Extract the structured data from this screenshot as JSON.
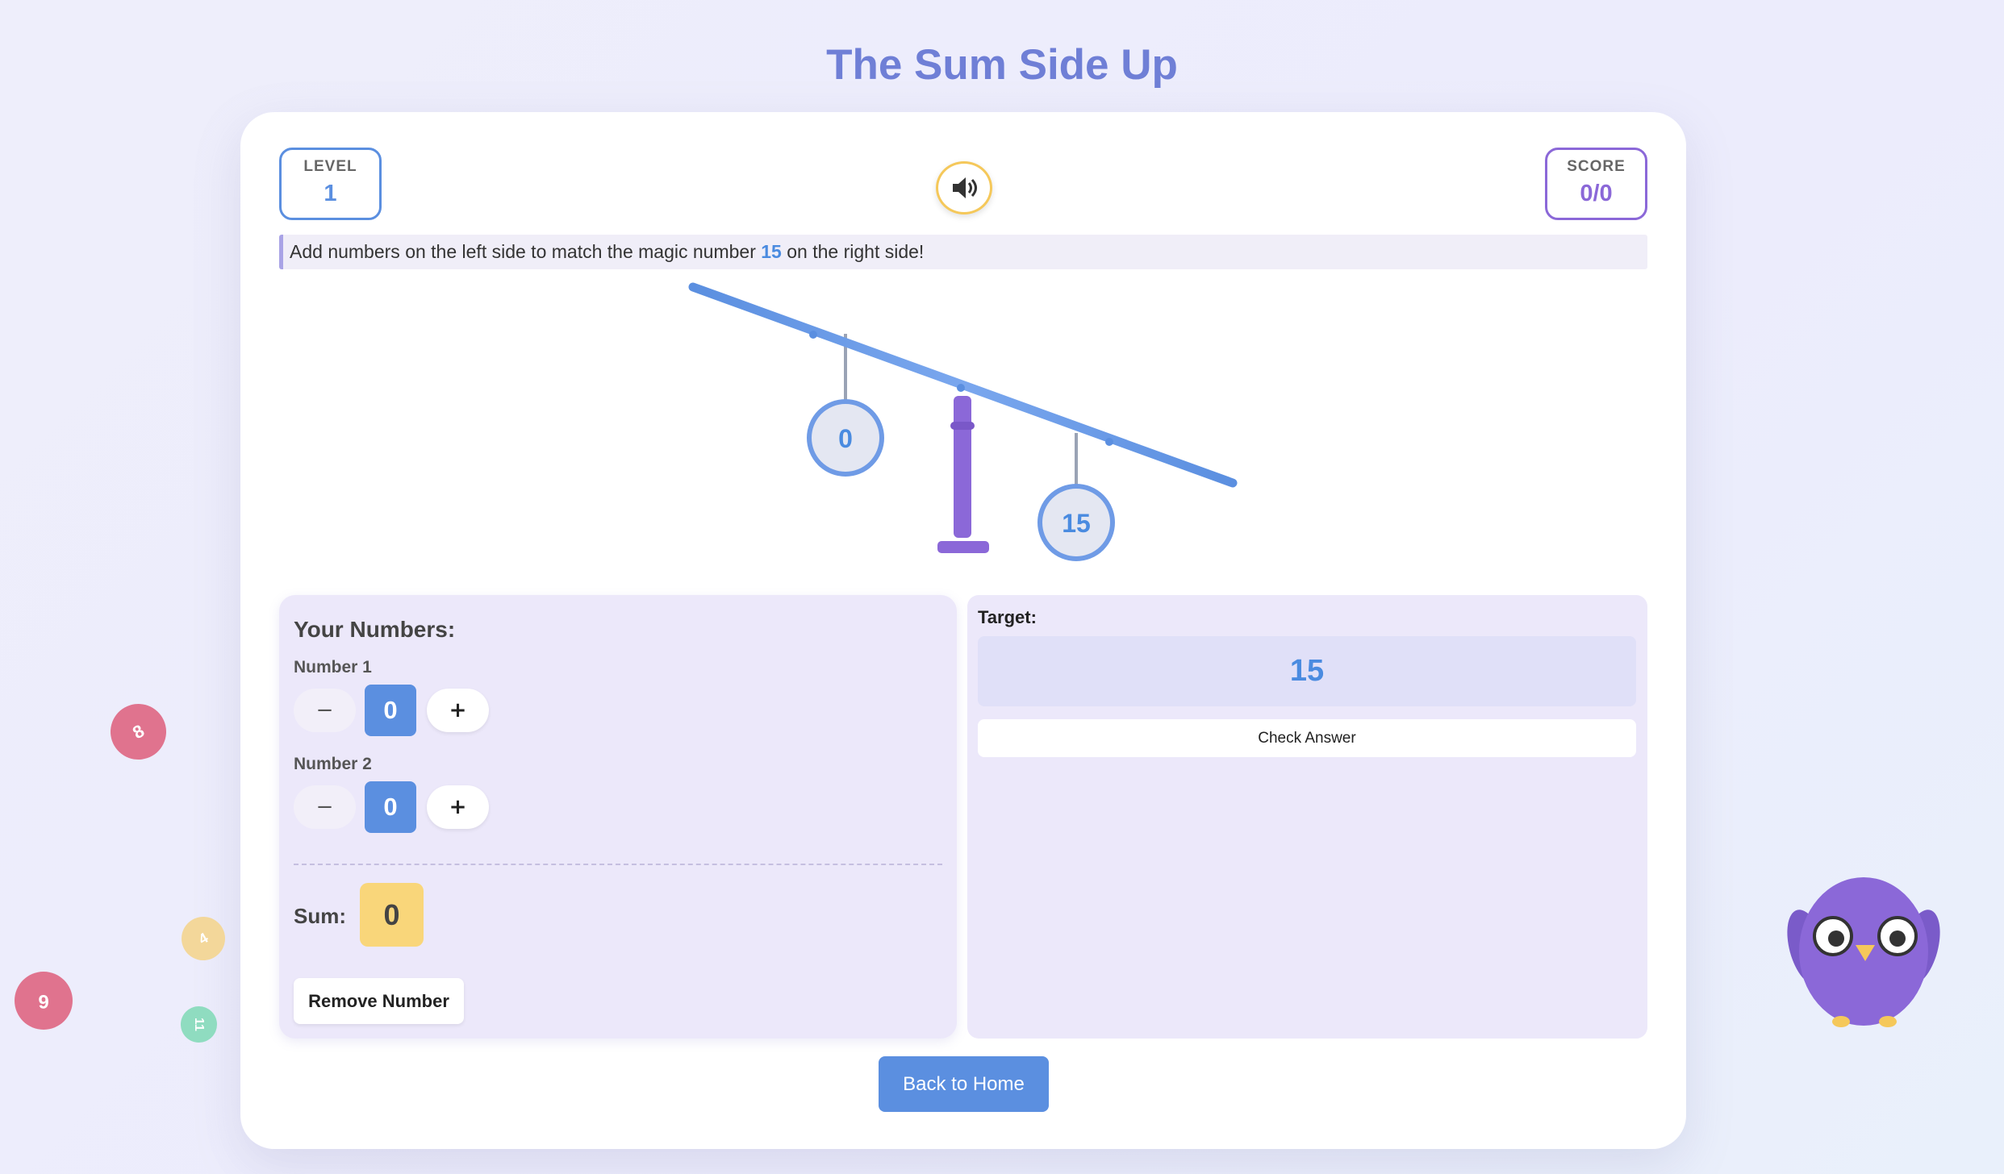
{
  "title": "The Sum Side Up",
  "level": {
    "label": "LEVEL",
    "value": "1"
  },
  "score": {
    "label": "SCORE",
    "value": "0/0"
  },
  "sound_icon": "speaker-icon",
  "instruction": {
    "before": "Add numbers on the left side to match the magic number ",
    "magic_number": "15",
    "after": " on the right side!"
  },
  "scale": {
    "left_weight": "0",
    "right_weight": "15"
  },
  "your_numbers": {
    "heading": "Your Numbers:",
    "numbers": [
      {
        "label": "Number 1",
        "value": "0"
      },
      {
        "label": "Number 2",
        "value": "0"
      }
    ],
    "minus_symbol": "−",
    "plus_symbol": "+",
    "sum_label": "Sum:",
    "sum_value": "0",
    "remove_label": "Remove Number"
  },
  "target": {
    "label": "Target:",
    "value": "15",
    "check_label": "Check Answer"
  },
  "back_home_label": "Back to Home",
  "floating_numbers": [
    "8",
    "4",
    "6",
    "11"
  ],
  "colors": {
    "accent_blue": "#5b8fe0",
    "accent_purple": "#8b68d8",
    "sum_yellow": "#f9d67a",
    "bubble_pink": "#e0738e",
    "bubble_yellow": "#f3d79a",
    "bubble_green": "#8fdcc0"
  },
  "mascot_icon": "owl-mascot-icon"
}
